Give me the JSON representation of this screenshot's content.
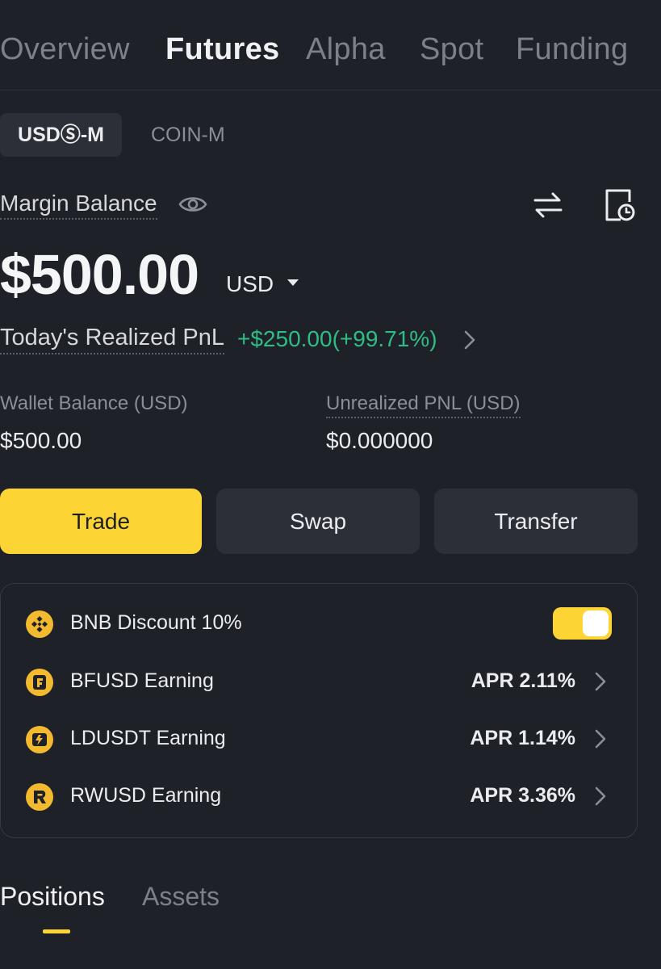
{
  "top_tabs": [
    "Overview",
    "Futures",
    "Alpha",
    "Spot",
    "Funding"
  ],
  "active_top_tab": "Futures",
  "sub_tabs": [
    "USDⓈ-M",
    "COIN-M"
  ],
  "active_sub_tab": "USDⓈ-M",
  "margin": {
    "label": "Margin Balance",
    "amount": "$500.00",
    "currency": "USD"
  },
  "pnl": {
    "label": "Today's Realized PnL",
    "value": "+$250.00(+99.71%)"
  },
  "stats": {
    "wallet_label": "Wallet Balance (USD)",
    "wallet_value": "$500.00",
    "unrealized_label": "Unrealized PNL (USD)",
    "unrealized_value": "$0.000000"
  },
  "actions": {
    "trade": "Trade",
    "swap": "Swap",
    "transfer": "Transfer"
  },
  "earn": {
    "bnb_discount": {
      "label": "BNB Discount 10%",
      "enabled": true
    },
    "items": [
      {
        "label": "BFUSD Earning",
        "apr": "APR 2.11%"
      },
      {
        "label": "LDUSDT Earning",
        "apr": "APR 1.14%"
      },
      {
        "label": "RWUSD Earning",
        "apr": "APR 3.36%"
      }
    ]
  },
  "bottom_tabs": [
    "Positions",
    "Assets"
  ],
  "active_bottom_tab": "Positions",
  "colors": {
    "background": "#1f2128",
    "accent_yellow": "#fcd535",
    "positive_green": "#2ebd85",
    "muted_text": "#8b8e97"
  }
}
